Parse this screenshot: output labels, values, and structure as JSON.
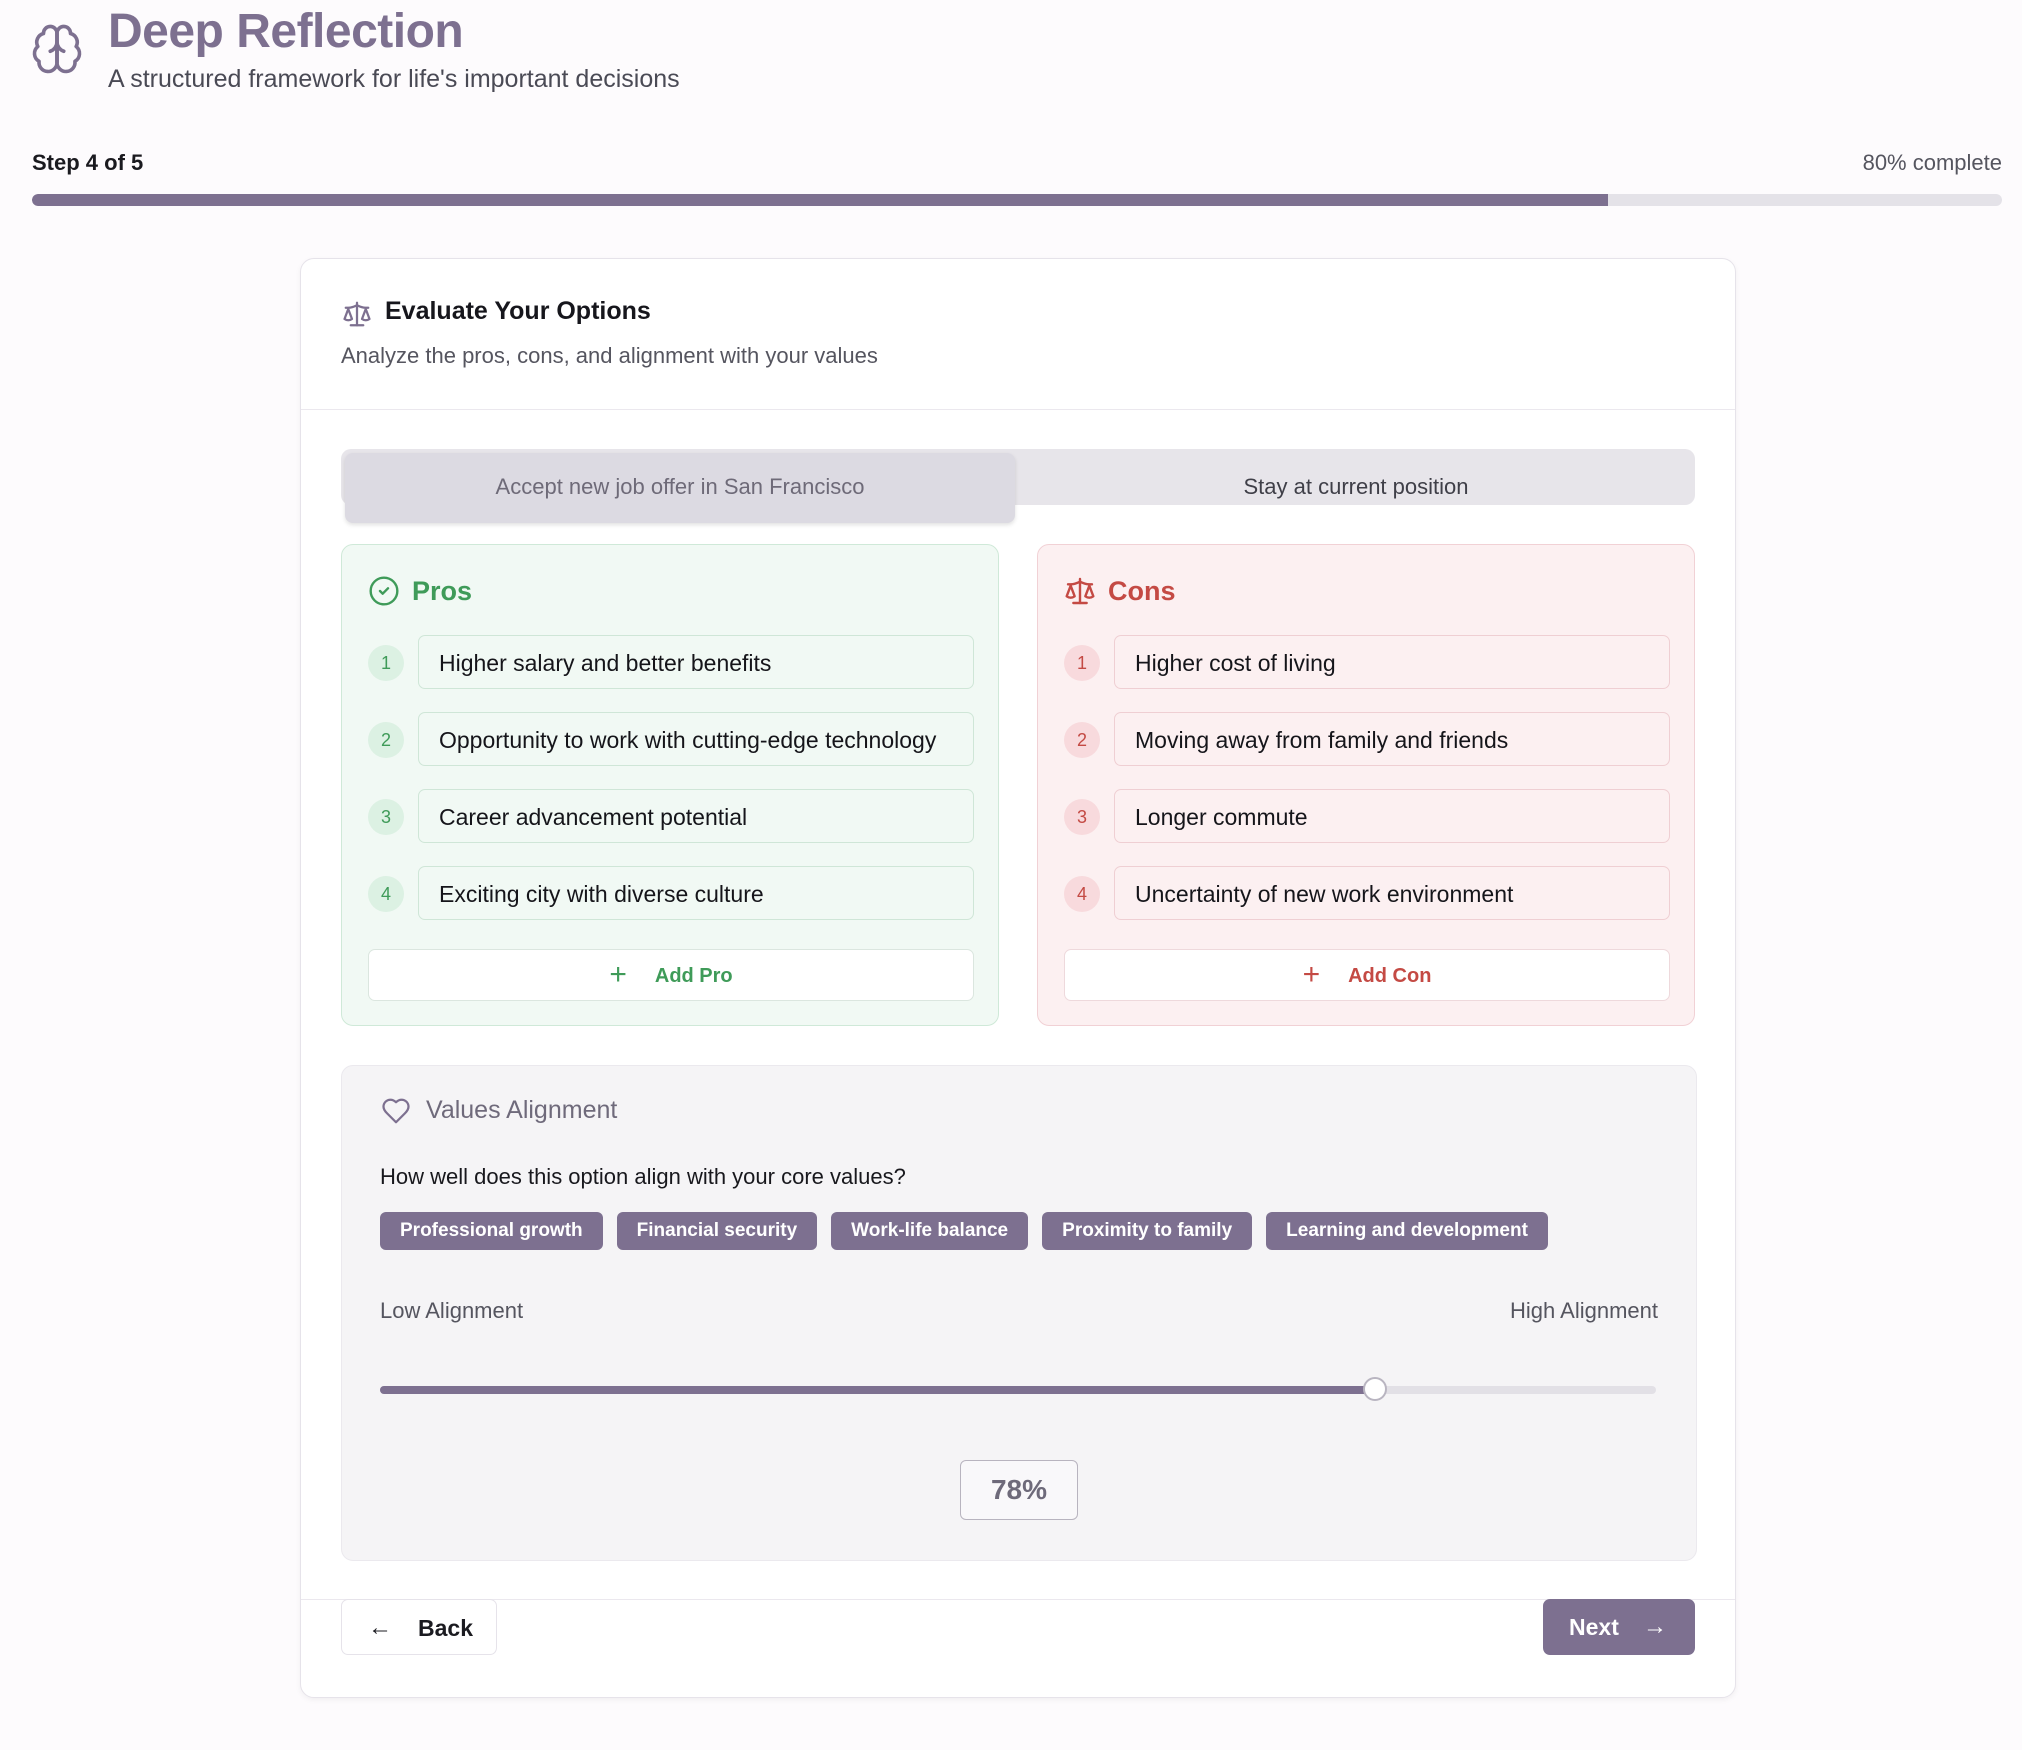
{
  "header": {
    "title": "Deep Reflection",
    "subtitle": "A structured framework for life's important decisions",
    "icon": "brain-icon"
  },
  "progress": {
    "step_label": "Step 4 of 5",
    "percent_label": "80% complete",
    "fraction": 0.8
  },
  "card": {
    "title": "Evaluate Your Options",
    "subtitle": "Analyze the pros, cons, and alignment with your values",
    "icon": "scale-icon"
  },
  "tabs": [
    {
      "label": "Accept new job offer in San Francisco",
      "active": true
    },
    {
      "label": "Stay at current position",
      "active": false
    }
  ],
  "pros": {
    "title": "Pros",
    "icon": "check-circle-icon",
    "items": [
      {
        "num": "1",
        "text": "Higher salary and better benefits"
      },
      {
        "num": "2",
        "text": "Opportunity to work with cutting-edge technology"
      },
      {
        "num": "3",
        "text": "Career advancement potential"
      },
      {
        "num": "4",
        "text": "Exciting city with diverse culture"
      }
    ],
    "add_label": "Add Pro"
  },
  "cons": {
    "title": "Cons",
    "icon": "scale-icon",
    "items": [
      {
        "num": "1",
        "text": "Higher cost of living"
      },
      {
        "num": "2",
        "text": "Moving away from family and friends"
      },
      {
        "num": "3",
        "text": "Longer commute"
      },
      {
        "num": "4",
        "text": "Uncertainty of new work environment"
      }
    ],
    "add_label": "Add Con"
  },
  "values": {
    "title": "Values Alignment",
    "icon": "heart-icon",
    "question": "How well does this option align with your core values?",
    "chips": [
      "Professional growth",
      "Financial security",
      "Work-life balance",
      "Proximity to family",
      "Learning and development"
    ],
    "low_label": "Low Alignment",
    "high_label": "High Alignment",
    "alignment_fraction": 0.78,
    "alignment_label": "78%"
  },
  "nav": {
    "back_label": "Back",
    "next_label": "Next"
  },
  "colors": {
    "accent": "#7d7090",
    "pros": "#3f9b59",
    "cons": "#c44a44"
  }
}
